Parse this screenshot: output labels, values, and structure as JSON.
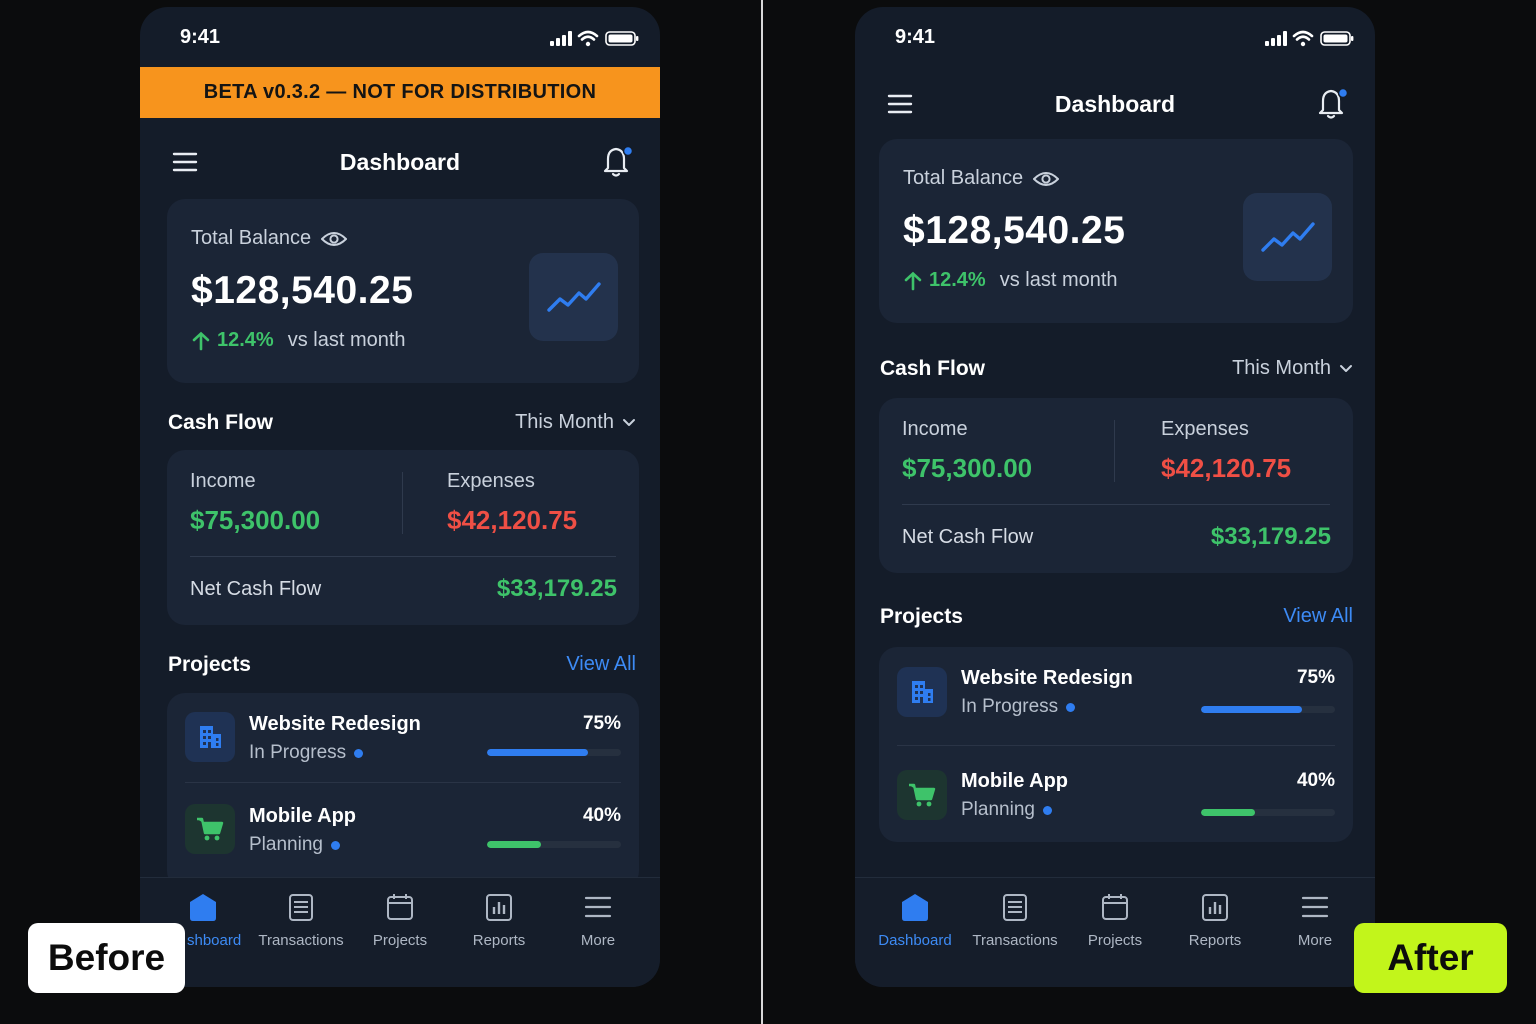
{
  "status_bar": {
    "time": "9:41"
  },
  "beta_banner": {
    "text": "BETA v0.3.2 — NOT FOR DISTRIBUTION"
  },
  "header": {
    "title": "Dashboard"
  },
  "balance": {
    "label": "Total Balance",
    "amount": "$128,540.25",
    "change_pct": "12.4%",
    "change_text": "vs last month"
  },
  "cash_flow": {
    "title": "Cash Flow",
    "period": "This Month",
    "income_label": "Income",
    "income_value": "$75,300.00",
    "expenses_label": "Expenses",
    "expenses_value": "$42,120.75",
    "net_label": "Net Cash Flow",
    "net_value": "$33,179.25"
  },
  "projects": {
    "title": "Projects",
    "view_all": "View All",
    "items": [
      {
        "name": "Website Redesign",
        "status": "In Progress",
        "percent_label": "75%",
        "progress": 0.75,
        "icon": "building-icon",
        "color": "#2f7df0"
      },
      {
        "name": "Mobile App",
        "status": "Planning",
        "percent_label": "40%",
        "progress": 0.4,
        "icon": "cart-icon",
        "color": "#3ec36a"
      }
    ]
  },
  "nav": {
    "before_items": [
      "shboard",
      "Transactions",
      "Projects",
      "Reports",
      "More"
    ],
    "after_items": [
      "Dashboard",
      "Transactions",
      "Projects",
      "Reports",
      "More"
    ]
  },
  "labels": {
    "before": "Before",
    "after": "After"
  },
  "colors": {
    "accent_blue": "#2f7df0",
    "positive_green": "#3ec36a",
    "negative_red": "#ef4f45",
    "banner_orange": "#f7941d",
    "after_badge": "#c2f51b",
    "phone_bg": "#141c29",
    "card_bg": "#1b2536"
  }
}
